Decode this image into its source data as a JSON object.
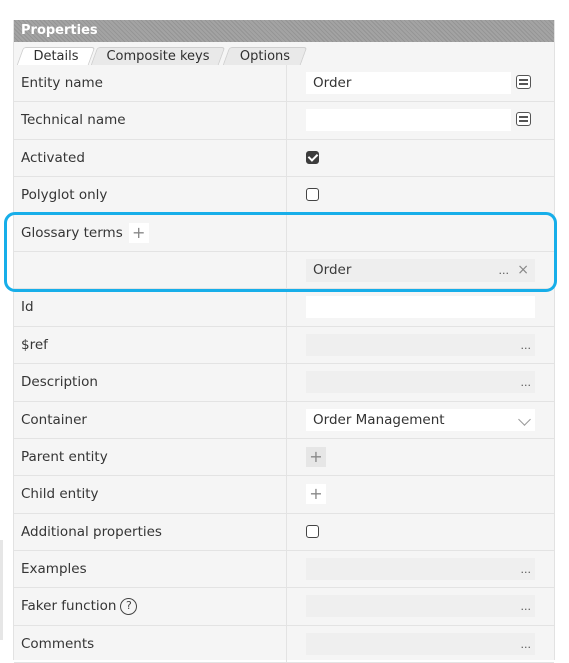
{
  "panel": {
    "title": "Properties"
  },
  "tabs": [
    {
      "label": "Details",
      "active": true
    },
    {
      "label": "Composite keys",
      "active": false
    },
    {
      "label": "Options",
      "active": false
    }
  ],
  "rows": {
    "entity_name": {
      "label": "Entity name",
      "value": "Order"
    },
    "technical_name": {
      "label": "Technical name",
      "value": ""
    },
    "activated": {
      "label": "Activated",
      "checked": true
    },
    "polyglot_only": {
      "label": "Polyglot only",
      "checked": false
    },
    "glossary_terms": {
      "label": "Glossary terms",
      "add_symbol": "+"
    },
    "glossary_term_item": {
      "value": "Order",
      "browse": "...",
      "remove": "×"
    },
    "id": {
      "label": "Id",
      "value": ""
    },
    "ref": {
      "label": "$ref",
      "browse": "..."
    },
    "description": {
      "label": "Description",
      "browse": "..."
    },
    "container": {
      "label": "Container",
      "value": "Order Management"
    },
    "parent_entity": {
      "label": "Parent entity",
      "add_symbol": "+"
    },
    "child_entity": {
      "label": "Child entity",
      "add_symbol": "+"
    },
    "additional_properties": {
      "label": "Additional properties",
      "checked": false
    },
    "examples": {
      "label": "Examples",
      "browse": "..."
    },
    "faker_function": {
      "label": "Faker function",
      "help": "?",
      "browse": "..."
    },
    "comments": {
      "label": "Comments",
      "browse": "..."
    }
  },
  "colors": {
    "highlight": "#17aee9",
    "header": "#9b9b9b"
  }
}
